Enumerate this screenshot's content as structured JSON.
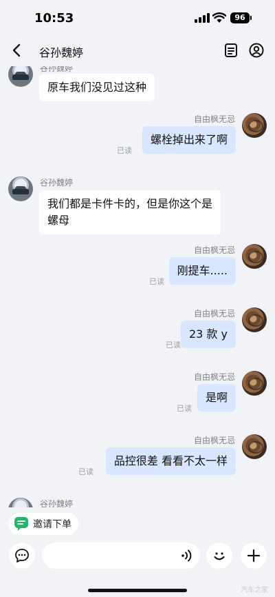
{
  "status_bar": {
    "time": "10:53",
    "battery": "96"
  },
  "header": {
    "title": "谷孙魏婷",
    "back_icon": "chevron-left-icon",
    "menu_icon": "document-list-icon",
    "profile_icon": "user-circle-icon"
  },
  "messages": [
    {
      "side": "left",
      "sender": "谷孙魏婷",
      "text": "原车我们没见过这种"
    },
    {
      "side": "right",
      "sender": "自由枫无忌",
      "text": "螺栓掉出来了啊",
      "read": "已读"
    },
    {
      "side": "left",
      "sender": "谷孙魏婷",
      "line1": "我们都是卡件卡的，但是你这个是",
      "line2": "螺母"
    },
    {
      "side": "right",
      "sender": "自由枫无忌",
      "text": "刚提车.....",
      "read": "已读"
    },
    {
      "side": "right",
      "sender": "自由枫无忌",
      "text": "23 款 y",
      "read": "已读"
    },
    {
      "side": "right",
      "sender": "自由枫无忌",
      "text": "是啊",
      "read": "已读"
    },
    {
      "side": "right",
      "sender": "自由枫无忌",
      "text": "品控很差 看看不太一样",
      "read": "已读"
    },
    {
      "side": "left",
      "sender": "谷孙魏婷"
    }
  ],
  "quick_action": {
    "label": "邀请下单"
  },
  "input": {
    "value": "",
    "placeholder": ""
  },
  "watermark": "汽车之家",
  "colors": {
    "background": "#f2f3f6",
    "bubble_left": "#ffffff",
    "bubble_right": "#d8e6ff",
    "muted": "#7f8288"
  }
}
